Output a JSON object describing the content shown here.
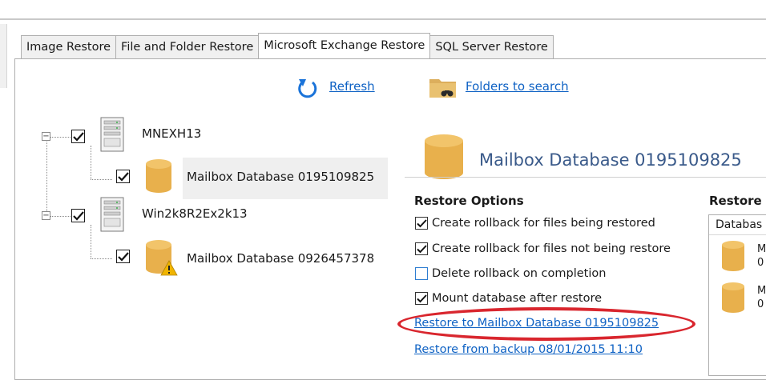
{
  "tabs": [
    {
      "label": "Image Restore"
    },
    {
      "label": "File and Folder Restore"
    },
    {
      "label": "Microsoft Exchange Restore"
    },
    {
      "label": "SQL Server Restore"
    }
  ],
  "toolbar": {
    "refresh_label": "Refresh",
    "folders_label": "Folders to search"
  },
  "tree": {
    "servers": [
      {
        "name": "MNEXH13",
        "checked": true,
        "databases": [
          {
            "name": "Mailbox Database 0195109825",
            "checked": true,
            "selected": true,
            "warning": false
          }
        ]
      },
      {
        "name": "Win2k8R2Ex2k13",
        "checked": true,
        "databases": [
          {
            "name": "Mailbox Database 0926457378",
            "checked": true,
            "selected": false,
            "warning": true
          }
        ]
      }
    ]
  },
  "details": {
    "database_title": "Mailbox Database 0195109825",
    "restore_options_heading": "Restore Options",
    "options": [
      {
        "label": "Create rollback for files being restored",
        "checked": true
      },
      {
        "label": "Create rollback for files not being restore",
        "checked": true
      },
      {
        "label": "Delete rollback on completion",
        "checked": false
      },
      {
        "label": "Mount database after restore",
        "checked": true
      }
    ],
    "restore_to_link": "Restore to Mailbox Database 0195109825",
    "restore_from_link": "Restore from backup 08/01/2015 11:10"
  },
  "right_panel": {
    "heading": "Restore",
    "column_header": "Databas",
    "items": [
      {
        "line1": "M",
        "line2": "0"
      },
      {
        "line1": "M",
        "line2": "0"
      }
    ]
  },
  "colors": {
    "link": "#0f62c4",
    "highlight_ellipse": "#d9262e",
    "database_icon": "#e8b04c",
    "warning_icon": "#f0b400"
  }
}
